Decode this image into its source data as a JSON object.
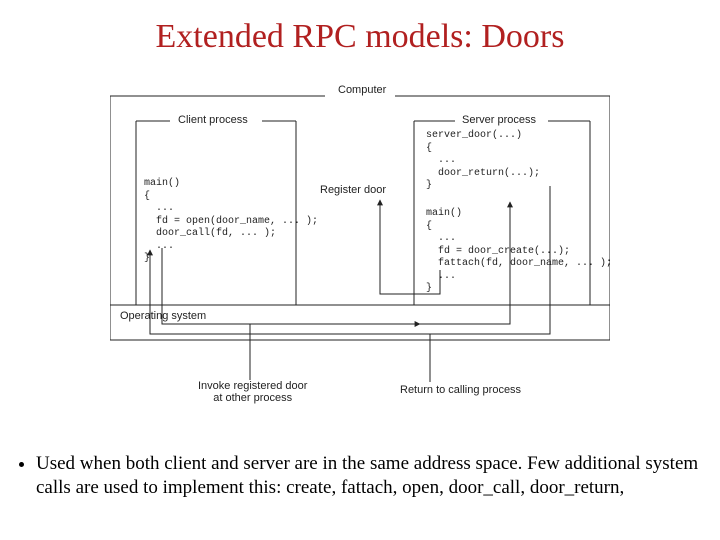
{
  "title": "Extended RPC models: Doors",
  "diagram": {
    "computer_label": "Computer",
    "client_process_label": "Client process",
    "server_process_label": "Server process",
    "register_door_label": "Register door",
    "operating_system_label": "Operating system",
    "invoke_label": "Invoke registered door\nat other process",
    "return_label": "Return to calling process",
    "client_code": "main()\n{\n  ...\n  fd = open(door_name, ... );\n  door_call(fd, ... );\n  ...\n}",
    "server_door_code": "server_door(...)\n{\n  ...\n  door_return(...);\n}",
    "server_main_code": "main()\n{\n  ...\n  fd = door_create(...);\n  fattach(fd, door_name, ... );\n  ...\n}"
  },
  "bullet": "Used when both client and server are in the same address space.  Few additional system calls are used to implement this: create,  fattach, open, door_call, door_return,"
}
